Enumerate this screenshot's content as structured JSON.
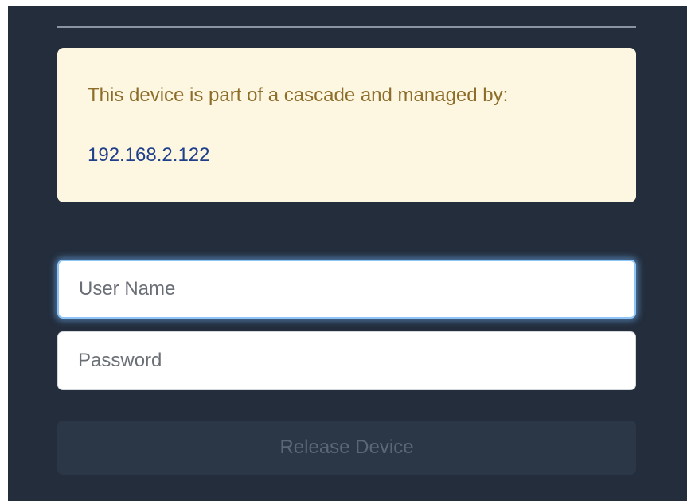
{
  "notice": {
    "message": "This device is part of a cascade and managed by:",
    "manager_ip": "192.168.2.122"
  },
  "login": {
    "username_placeholder": "User Name",
    "password_placeholder": "Password",
    "release_label": "Release Device"
  },
  "colors": {
    "panel_bg": "#232d3c",
    "notice_bg": "#fdf6e1",
    "notice_text": "#8d6d2a",
    "ip_text": "#1f3f8a",
    "focus_glow": "#8ec4f6"
  }
}
